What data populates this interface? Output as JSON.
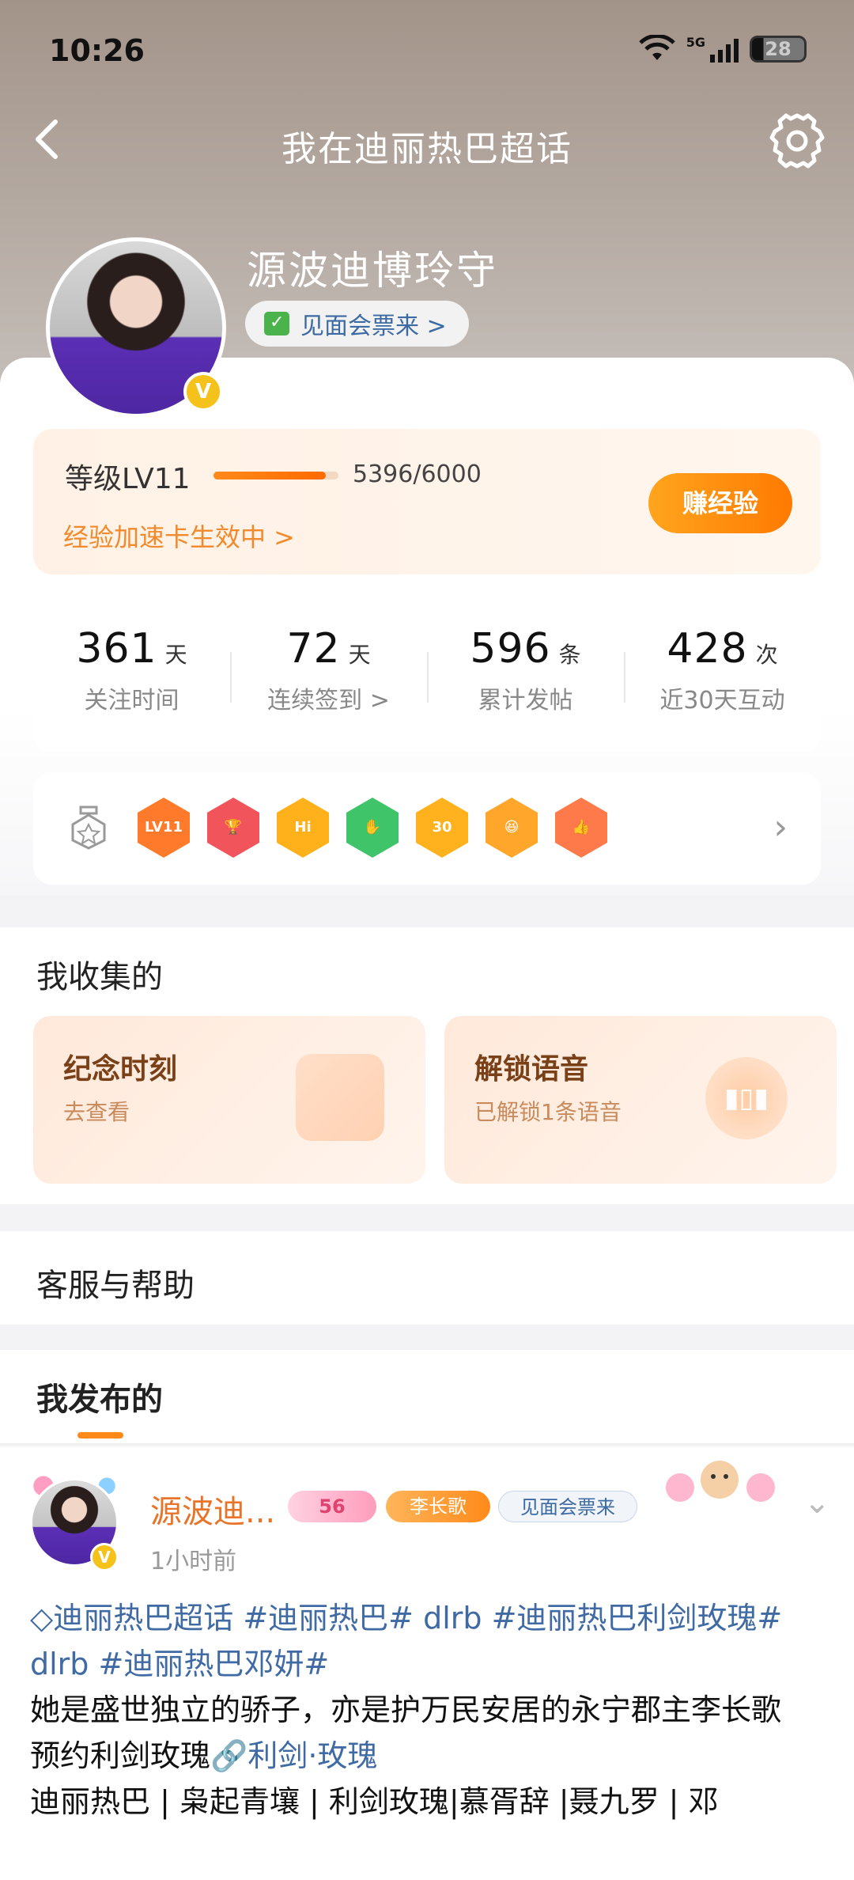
{
  "status_bar": {
    "time": "10:26",
    "network": "5G",
    "battery": "28"
  },
  "header": {
    "title": "我在迪丽热巴超话"
  },
  "profile": {
    "name": "源波迪博玲守",
    "meet_pill": "见面会票来 >",
    "verified_badge": "V"
  },
  "level": {
    "label": "等级LV11",
    "progress": 0.899,
    "exp_text": "5396/6000",
    "boost_text": "经验加速卡生效中 >",
    "earn_button": "赚经验"
  },
  "stats": [
    {
      "num": "361",
      "unit": "天",
      "label": "关注时间"
    },
    {
      "num": "72",
      "unit": "天",
      "label": "连续签到 >"
    },
    {
      "num": "596",
      "unit": "条",
      "label": "累计发帖"
    },
    {
      "num": "428",
      "unit": "次",
      "label": "近30天互动"
    }
  ],
  "medals": [
    {
      "text": "LV11",
      "color": "#ff7a2a"
    },
    {
      "text": "🏆",
      "color": "#f2545b"
    },
    {
      "text": "Hi",
      "color": "#ffb11c"
    },
    {
      "text": "✋",
      "color": "#3fc46a"
    },
    {
      "text": "30",
      "color": "#ffb21d"
    },
    {
      "text": "😆",
      "color": "#ffa62b"
    },
    {
      "text": "👍",
      "color": "#ff7a4a"
    }
  ],
  "collection": {
    "title": "我收集的",
    "cards": [
      {
        "title": "纪念时刻",
        "sub": "去查看"
      },
      {
        "title": "解锁语音",
        "sub": "已解锁1条语音"
      }
    ]
  },
  "help": {
    "title": "客服与帮助"
  },
  "posts_tab": {
    "title": "我发布的"
  },
  "post": {
    "author": "源波迪...",
    "fan_level": "56",
    "honor_tag": "李长歌",
    "ticket_tag": "见面会票来",
    "time": "1小时前",
    "line1_link": "迪丽热巴超话 #迪丽热巴# dlrb #迪丽热巴利剑玫瑰# dlrb #迪丽热巴邓妍#",
    "line2": "她是盛世独立的骄子，亦是护万民安居的永宁郡主李长歌",
    "line3_prefix": "预约利剑玫瑰",
    "line3_link": "利剑·玫瑰",
    "line4": "迪丽热巴 | 枭起青壤 | 利剑玫瑰|慕胥辞 |聂九罗 | 邓"
  }
}
